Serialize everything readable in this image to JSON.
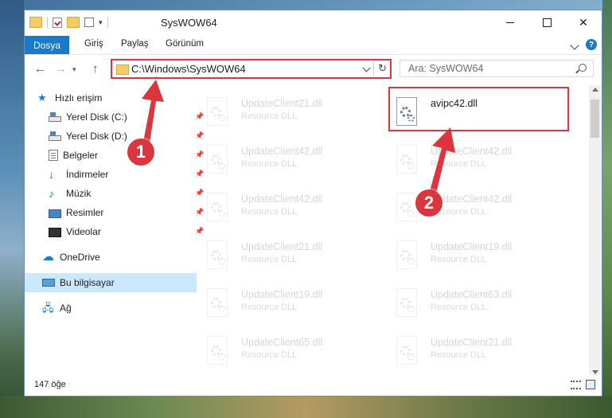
{
  "window": {
    "title": "SysWOW64",
    "min_symbol": "",
    "close_symbol": "✕"
  },
  "ribbon": {
    "tabs": [
      "Dosya",
      "Giriş",
      "Paylaş",
      "Görünüm"
    ],
    "collapse_icon": "chevron-up-icon",
    "help_label": "?"
  },
  "nav": {
    "back": "←",
    "forward": "→",
    "up": "↑",
    "address": "C:\\Windows\\SysWOW64",
    "refresh": "↻",
    "search_placeholder": "Ara: SysWOW64"
  },
  "sidebar": {
    "items": [
      {
        "label": "Hızlı erişim"
      },
      {
        "label": "Yerel Disk (C:)"
      },
      {
        "label": "Yerel Disk (D:)"
      },
      {
        "label": "Belgeler"
      },
      {
        "label": "İndirmeler"
      },
      {
        "label": "Müzik"
      },
      {
        "label": "Resimler"
      },
      {
        "label": "Videolar"
      },
      {
        "label": "OneDrive"
      },
      {
        "label": "Bu bilgisayar"
      },
      {
        "label": "Ağ"
      }
    ],
    "selected": "Bu bilgisayar"
  },
  "files": {
    "left": [
      {
        "name": "UpdateClient21.dll",
        "type": "Resource DLL"
      },
      {
        "name": "UpdateClient42.dll",
        "type": "Resource DLL"
      },
      {
        "name": "UpdateClient42.dll",
        "type": "Resource DLL"
      },
      {
        "name": "UpdateClient21.dll",
        "type": "Resource DLL"
      },
      {
        "name": "UpdateClient19.dll",
        "type": "Resource DLL"
      },
      {
        "name": "UpdateClient65.dll",
        "type": "Resource DLL"
      }
    ],
    "right": [
      {
        "name": "avipc42.dll",
        "type": ""
      },
      {
        "name": "UpdateClient42.dll",
        "type": "Resource DLL"
      },
      {
        "name": "UpdateClient42.dll",
        "type": "Resource DLL"
      },
      {
        "name": "UpdateClient19.dll",
        "type": "Resource DLL"
      },
      {
        "name": "UpdateClient63.dll",
        "type": "Resource DLL"
      },
      {
        "name": "UpdateClient21.dll",
        "type": "Resource DLL"
      }
    ]
  },
  "status": {
    "item_count": "147 öğe"
  },
  "annotations": {
    "step1": "1",
    "step2": "2",
    "highlight_color": "#d9363e"
  },
  "colors": {
    "accent": "#1979ca",
    "selection": "#cce8ff"
  }
}
